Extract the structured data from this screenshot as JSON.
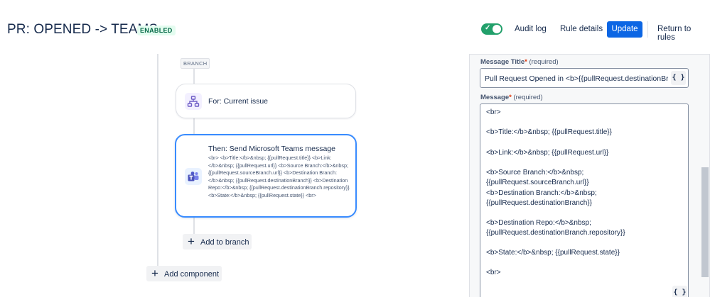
{
  "header": {
    "title": "PR: OPENED -> TEAMS",
    "status": "ENABLED",
    "toggle_check": "✓",
    "audit_log": "Audit log",
    "rule_details": "Rule details",
    "update": "Update",
    "return": "Return to rules"
  },
  "flow": {
    "branch_label": "BRANCH",
    "condition_label": "For: Current issue",
    "action_title": "Then: Send Microsoft Teams message",
    "action_body": "<br> <b>Title:</b>&nbsp; {{pullRequest.title}} <b>Link:</b>&nbsp; {{pullRequest.url}} <b>Source Branch:</b>&nbsp; {{pullRequest.sourceBranch.url}} <b>Destination Branch:</b>&nbsp; {{pullRequest.destinationBranch}} <b>Destination Repo:</b>&nbsp; {{pullRequest.destinationBranch.repository}} <b>State:</b>&nbsp; {{pullRequest.state}} <br>",
    "add_to_branch": "Add to branch",
    "add_component": "Add component"
  },
  "panel": {
    "title_label": "Message Title",
    "title_required": "(required)",
    "title_value": "Pull Request Opened in <b>{{pullRequest.destinationBranch",
    "curly": "{ }",
    "message_label": "Message",
    "message_required": "(required)",
    "message_lines": [
      "<br>",
      "<b>Title:</b>&nbsp;  {{pullRequest.title}}",
      "<b>Link:</b>&nbsp; {{pullRequest.url}}",
      "<b>Source Branch:</b>&nbsp;  {{pullRequest.sourceBranch.url}}",
      "<b>Destination Branch:</b>&nbsp;",
      "{{pullRequest.destinationBranch}}",
      "<b>Destination Repo:</b>&nbsp;",
      "{{pullRequest.destinationBranch.repository}}",
      "<b>State:</b>&nbsp;  {{pullRequest.state}}",
      "<br>"
    ]
  },
  "icons": {
    "toggle": "check-icon",
    "condition": "branch-hierarchy-icon",
    "action": "microsoft-teams-icon",
    "add": "plus-icon"
  },
  "colors": {
    "primary": "#0c66e4",
    "enabled": "#22a06b",
    "selected_border": "#388bff",
    "teams": "#5059c9"
  }
}
